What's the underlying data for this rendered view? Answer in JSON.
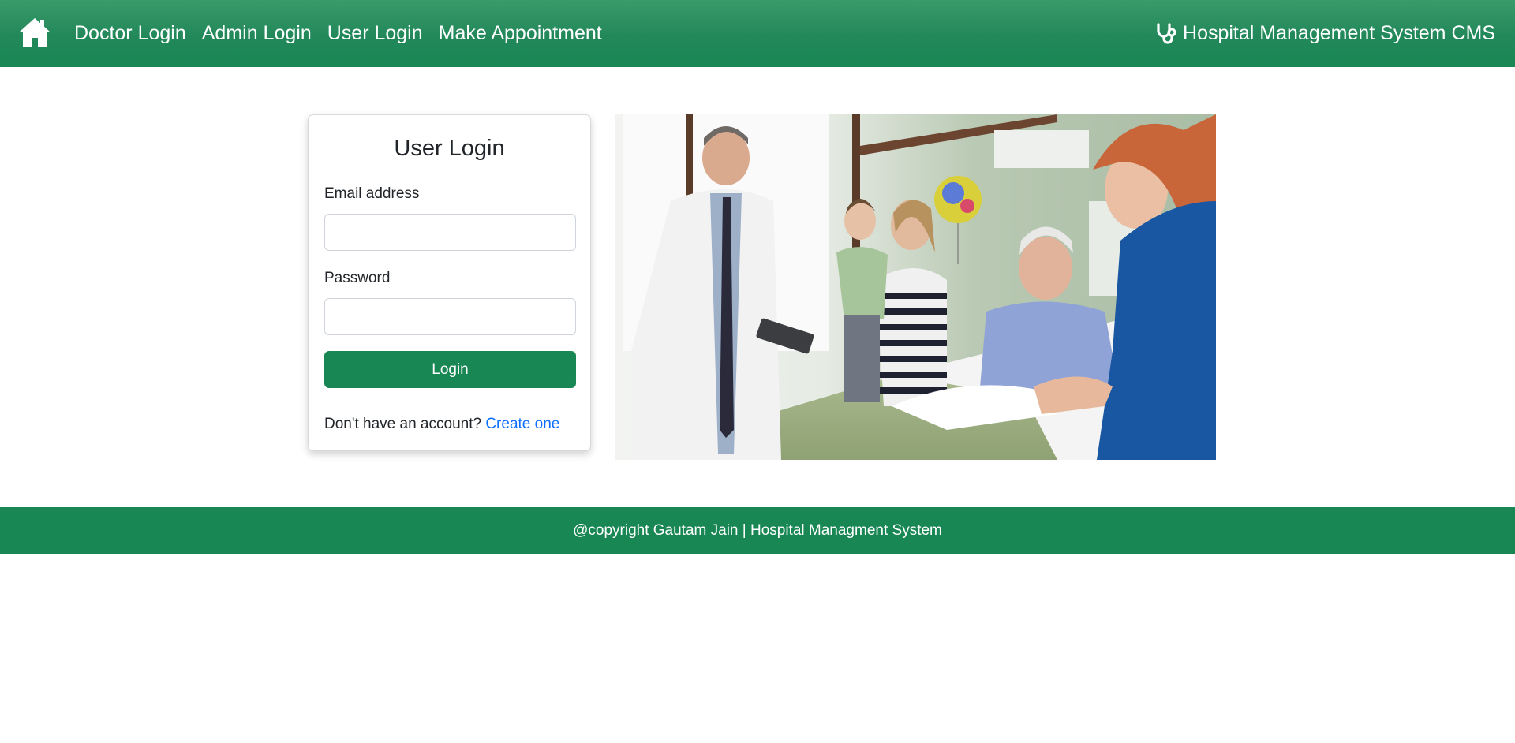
{
  "nav": {
    "items": [
      {
        "label": "Doctor Login"
      },
      {
        "label": "Admin Login"
      },
      {
        "label": "User Login"
      },
      {
        "label": "Make Appointment"
      }
    ],
    "brand": "Hospital Management System CMS"
  },
  "login": {
    "title": "User Login",
    "email_label": "Email address",
    "email_value": "",
    "password_label": "Password",
    "password_value": "",
    "button_label": "Login",
    "signup_prompt": "Don't have an account?",
    "signup_link": "Create one"
  },
  "footer": {
    "text": "@copyright Gautam Jain | Hospital Managment System"
  },
  "colors": {
    "primary": "#198754",
    "link": "#0d6efd"
  },
  "icons": {
    "home": "home-icon",
    "brand": "stethoscope-icon"
  }
}
